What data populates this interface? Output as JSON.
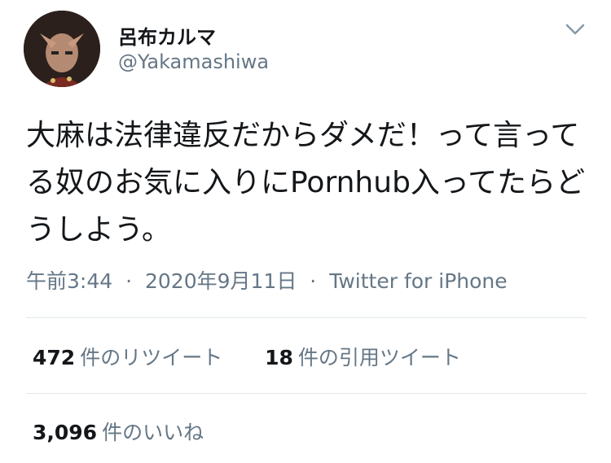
{
  "user": {
    "display_name": "呂布カルマ",
    "handle": "@Yakamashiwa",
    "avatar_icon": "user-avatar"
  },
  "menu_icon": "chevron-down-icon",
  "tweet": {
    "text": "大麻は法律違反だからダメだ！って言ってる奴のお気に入りにPornhub入ってたらどうしよう。",
    "time": "午前3:44",
    "date": "2020年9月11日",
    "separator": "·",
    "source": "Twitter for iPhone"
  },
  "stats": {
    "retweets_count": "472",
    "retweets_label": "件のリツイート",
    "quotes_count": "18",
    "quotes_label": "件の引用ツイート",
    "likes_count": "3,096",
    "likes_label": "件のいいね"
  },
  "colors": {
    "text": "#14171a",
    "secondary": "#657786",
    "divider": "#e1e8ed"
  }
}
